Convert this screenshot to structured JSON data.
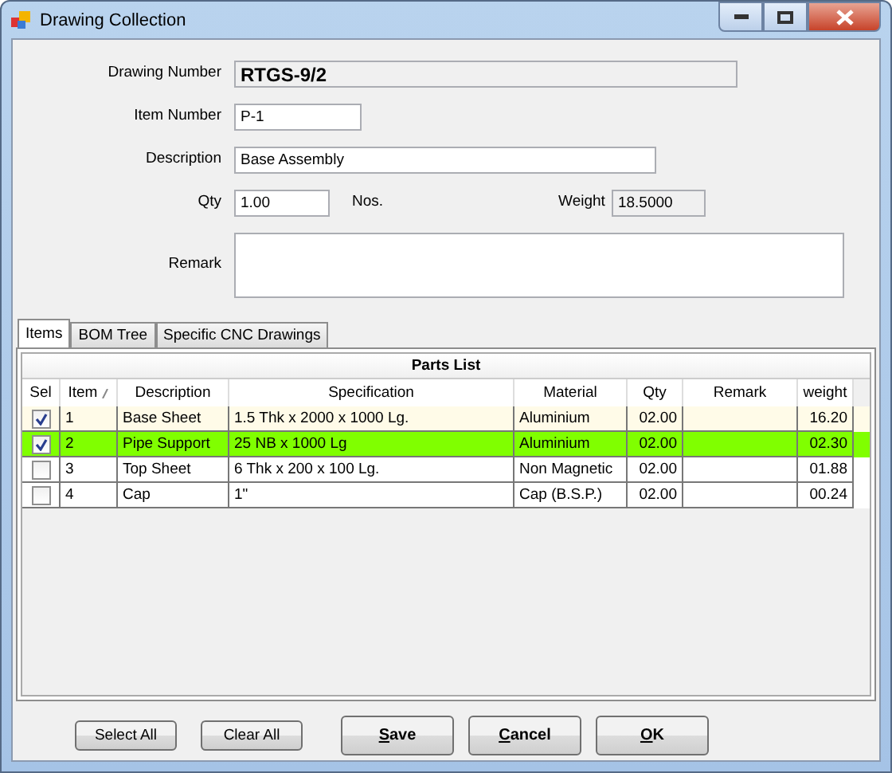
{
  "window": {
    "title": "Drawing Collection"
  },
  "form": {
    "drawing_number": {
      "label": "Drawing Number",
      "value": "RTGS-9/2"
    },
    "item_number": {
      "label": "Item Number",
      "value": "P-1"
    },
    "description": {
      "label": "Description",
      "value": "Base Assembly"
    },
    "qty": {
      "label": "Qty",
      "value": "1.00",
      "unit": "Nos."
    },
    "weight": {
      "label": "Weight",
      "value": "18.5000"
    },
    "remark": {
      "label": "Remark"
    }
  },
  "tabs": [
    {
      "label": "Items",
      "selected": true
    },
    {
      "label": "BOM Tree",
      "selected": false
    },
    {
      "label": "Specific CNC Drawings",
      "selected": false
    }
  ],
  "table": {
    "title": "Parts List",
    "columns": [
      "Sel",
      "Item",
      "Description",
      "Specification",
      "Material",
      "Qty",
      "Remark",
      "weight"
    ],
    "rows": [
      {
        "checked": true,
        "color": "#fffbe8",
        "cells": [
          "",
          "1",
          "Base Sheet",
          "1.5 Thk x 2000 x 1000 Lg.",
          "Aluminium",
          "02.00",
          "",
          "16.20"
        ]
      },
      {
        "checked": true,
        "color": "#80ff00",
        "cells": [
          "",
          "2",
          "Pipe Support",
          "25 NB x 1000 Lg",
          "Aluminium",
          "02.00",
          "",
          "02.30"
        ]
      },
      {
        "checked": false,
        "color": "#ffffff",
        "cells": [
          "",
          "3",
          "Top Sheet",
          "6 Thk x 200 x 100 Lg.",
          "Non Magnetic",
          "02.00",
          "",
          "01.88"
        ]
      },
      {
        "checked": false,
        "color": "#ffffff",
        "cells": [
          "",
          "4",
          "Cap",
          "1\"",
          "Cap (B.S.P.)",
          "02.00",
          "",
          "00.24"
        ]
      }
    ]
  },
  "buttons": {
    "left": [
      "Select All",
      "Clear All"
    ],
    "right": [
      "Save",
      "Cancel",
      "OK"
    ]
  }
}
